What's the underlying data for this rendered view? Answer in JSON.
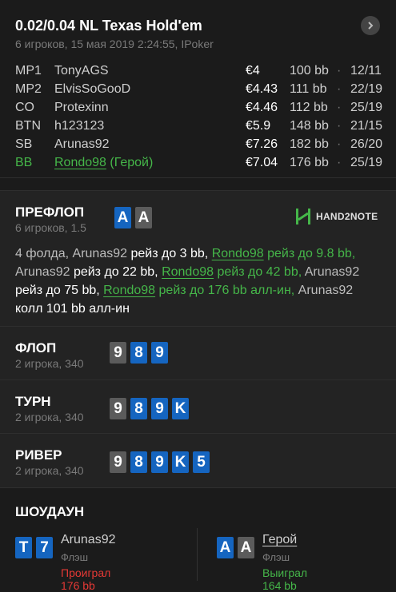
{
  "header": {
    "title": "0.02/0.04 NL Texas Hold'em",
    "subtitle": "6 игроков, 15 мая 2019 2:24:55, IPoker"
  },
  "players": [
    {
      "pos": "MP1",
      "name": "TonyAGS",
      "money": "€4",
      "bb": "100 bb",
      "count": "12/11"
    },
    {
      "pos": "MP2",
      "name": "ElvisSoGooD",
      "money": "€4.43",
      "bb": "111 bb",
      "count": "22/19"
    },
    {
      "pos": "CO",
      "name": "Protexinn",
      "money": "€4.46",
      "bb": "112 bb",
      "count": "25/19"
    },
    {
      "pos": "BTN",
      "name": "h123123",
      "money": "€5.9",
      "bb": "148 bb",
      "count": "21/15"
    },
    {
      "pos": "SB",
      "name": "Arunas92",
      "money": "€7.26",
      "bb": "182 bb",
      "count": "26/20"
    },
    {
      "pos": "BB",
      "name": "Rondo98",
      "hero_tag": "(Герой)",
      "money": "€7.04",
      "bb": "176 bb",
      "count": "25/19"
    }
  ],
  "separator": "·",
  "preflop": {
    "title": "ПРЕФЛОП",
    "sub": "6 игроков, 1.5",
    "cards": [
      "A",
      "A"
    ],
    "logo": "HAND2NOTE",
    "actions": {
      "a1": "4 фолда, ",
      "a2": "Arunas92",
      "a3": " рейз до 3 bb, ",
      "a4": "Rondo98",
      "a5": " рейз до 9.8 bb,",
      "a6": "Arunas92",
      "a7": " рейз до 22 bb, ",
      "a8": "Rondo98",
      "a9": " рейз до 42 bb, ",
      "a10": "Arunas92",
      "a11": "рейз до 75 bb, ",
      "a12": "Rondo98",
      "a13": " рейз до 176 bb алл-ин, ",
      "a14": "Arunas92",
      "a15": "колл 101 bb алл-ин"
    }
  },
  "flop": {
    "title": "ФЛОП",
    "sub": "2 игрока, 340",
    "cards": [
      "9",
      "8",
      "9"
    ]
  },
  "turn": {
    "title": "ТУРН",
    "sub": "2 игрока, 340",
    "cards": [
      "9",
      "8",
      "9",
      "K"
    ]
  },
  "river": {
    "title": "РИВЕР",
    "sub": "2 игрока, 340",
    "cards": [
      "9",
      "8",
      "9",
      "K",
      "5"
    ]
  },
  "showdown": {
    "title": "ШОУДАУН",
    "left": {
      "cards": [
        "T",
        "7"
      ],
      "name": "Arunas92",
      "hand": "Флэш",
      "result": "Проиграл 176 bb"
    },
    "right": {
      "cards": [
        "A",
        "A"
      ],
      "name": "Герой",
      "hand": "Флэш",
      "result": "Выиграл 164 bb"
    }
  },
  "colors": {
    "background": "#1b1b1b",
    "section": "#232323",
    "hero_green": "#45b649",
    "lose_red": "#e53935",
    "card_blue": "#1565c0",
    "card_grey": "#5b5b5b"
  },
  "icons": {
    "next": "chevron-right-icon",
    "logo": "hand2note-logo-icon"
  }
}
